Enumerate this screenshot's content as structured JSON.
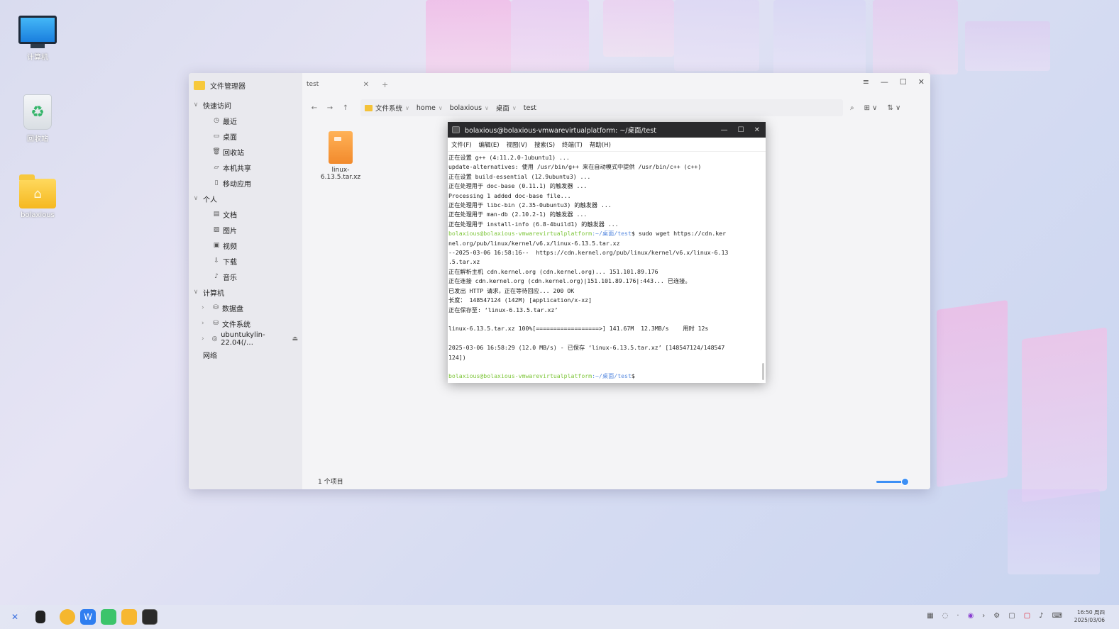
{
  "desktop": {
    "icons": [
      {
        "label": "计算机",
        "icon": "computer-icon"
      },
      {
        "label": "回收站",
        "icon": "trash-icon"
      },
      {
        "label": "bolaxious",
        "icon": "home-folder-icon"
      }
    ]
  },
  "file_manager": {
    "title": "文件管理器",
    "tab": {
      "label": "test"
    },
    "tab_add": "+",
    "sidebar": {
      "quick_access": {
        "label": "快速访问",
        "items": [
          "最近",
          "桌面",
          "回收站",
          "本机共享",
          "移动应用"
        ]
      },
      "personal": {
        "label": "个人",
        "items": [
          "文档",
          "图片",
          "视频",
          "下载",
          "音乐"
        ]
      },
      "computer": {
        "label": "计算机",
        "items": [
          "数据盘",
          "文件系统",
          "ubuntukylin-22.04(/…"
        ]
      },
      "network": "网络"
    },
    "breadcrumb": [
      "文件系统",
      "home",
      "bolaxious",
      "桌面",
      "test"
    ],
    "files": [
      {
        "name": "linux-6.13.5.tar.xz",
        "icon": "archive-icon"
      }
    ],
    "status": "1 个项目",
    "zoom_level": 0.5
  },
  "terminal": {
    "title": "bolaxious@bolaxious-vmwarevirtualplatform: ~/桌面/test",
    "menu": [
      "文件(F)",
      "编辑(E)",
      "视图(V)",
      "搜索(S)",
      "终端(T)",
      "帮助(H)"
    ],
    "lines": [
      "正在设置 g++ (4:11.2.0-1ubuntu1) ...",
      "update-alternatives: 使用 /usr/bin/g++ 来在自动模式中提供 /usr/bin/c++ (c++)",
      "正在设置 build-essential (12.9ubuntu3) ...",
      "正在处理用于 doc-base (0.11.1) 的触发器 ...",
      "Processing 1 added doc-base file...",
      "正在处理用于 libc-bin (2.35-0ubuntu3) 的触发器 ...",
      "正在处理用于 man-db (2.10.2-1) 的触发器 ...",
      "正在处理用于 install-info (6.8-4build1) 的触发器 ..."
    ],
    "prompt_user": "bolaxious@bolaxious-vmwarevirtualplatform",
    "prompt_path": ":~/桌面/test",
    "command": "$ sudo wget https://cdn.ker",
    "command_cont": "nel.org/pub/linux/kernel/v6.x/linux-6.13.5.tar.xz",
    "output": [
      "--2025-03-06 16:58:16--  https://cdn.kernel.org/pub/linux/kernel/v6.x/linux-6.13",
      ".5.tar.xz",
      "正在解析主机 cdn.kernel.org (cdn.kernel.org)... 151.101.89.176",
      "正在连接 cdn.kernel.org (cdn.kernel.org)|151.101.89.176|:443... 已连接。",
      "已发出 HTTP 请求，正在等待回应... 200 OK",
      "长度： 148547124 (142M) [application/x-xz]",
      "正在保存至: ‘linux-6.13.5.tar.xz’",
      "",
      "linux-6.13.5.tar.xz 100%[==================>] 141.67M  12.3MB/s    用时 12s",
      "",
      "2025-03-06 16:58:29 (12.0 MB/s) - 已保存 ‘linux-6.13.5.tar.xz’ [148547124/148547",
      "124])",
      ""
    ],
    "final_prompt_tail": "$"
  },
  "taskbar": {
    "start": "✕",
    "apps": [
      "multitask-icon",
      "file-manager-icon",
      "wps-icon",
      "software-center-icon",
      "file-manager-folder-icon",
      "terminal-icon"
    ],
    "clock_time": "16:50 周四",
    "clock_date": "2025/03/06"
  }
}
